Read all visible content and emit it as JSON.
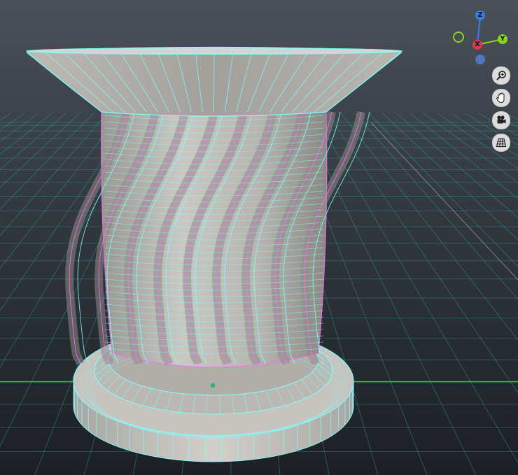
{
  "app": {
    "view": "3D viewport"
  },
  "colors": {
    "background_top": "#3a4047",
    "background_bottom": "#1e2226",
    "grid": "#2aa39a",
    "grid_axis_x": "#39d05a",
    "mesh_fill": "#bdb9b4",
    "mesh_shadow": "#8f8b86",
    "wire": "#7fffff",
    "wire_selected": "#ff66ff",
    "axis_x": "#e0344a",
    "axis_y": "#8ad21f",
    "axis_z": "#3a7de8",
    "axis_neg": "#4e76b8"
  },
  "gizmo": {
    "z_label": "Z",
    "x_label": "X",
    "y_label": "Y"
  },
  "toolbar": {
    "tools": [
      {
        "name": "zoom-icon"
      },
      {
        "name": "pan-hand-icon"
      },
      {
        "name": "camera-icon"
      },
      {
        "name": "perspective-grid-icon"
      }
    ]
  }
}
